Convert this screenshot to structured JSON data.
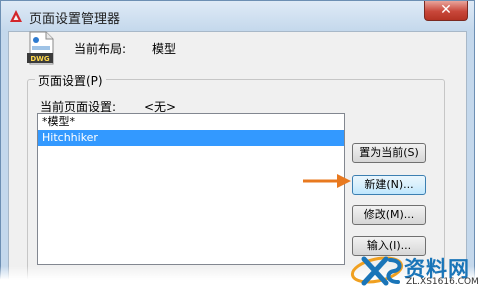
{
  "window": {
    "title": "页面设置管理器",
    "close_glyph": "✕"
  },
  "current_layout": {
    "label": "当前布局:",
    "value": "模型"
  },
  "dwg_icon_text": "DWG",
  "page_setups": {
    "group_title": "页面设置(P)",
    "current_label": "当前页面设置:",
    "current_value": "<无>",
    "items": [
      {
        "label": "*模型*",
        "selected": false
      },
      {
        "label": "Hitchhiker",
        "selected": true
      }
    ]
  },
  "buttons": {
    "set_current": "置为当前(S)",
    "new": "新建(N)...",
    "modify": "修改(M)...",
    "import": "输入(I)..."
  },
  "colors": {
    "title_bar": "#c4d8ec",
    "selection": "#3399ff",
    "arrow": "#e8791f",
    "close": "#c8473a"
  },
  "watermark": {
    "name": "资料网",
    "url": "ZL.XS1616.COM"
  }
}
